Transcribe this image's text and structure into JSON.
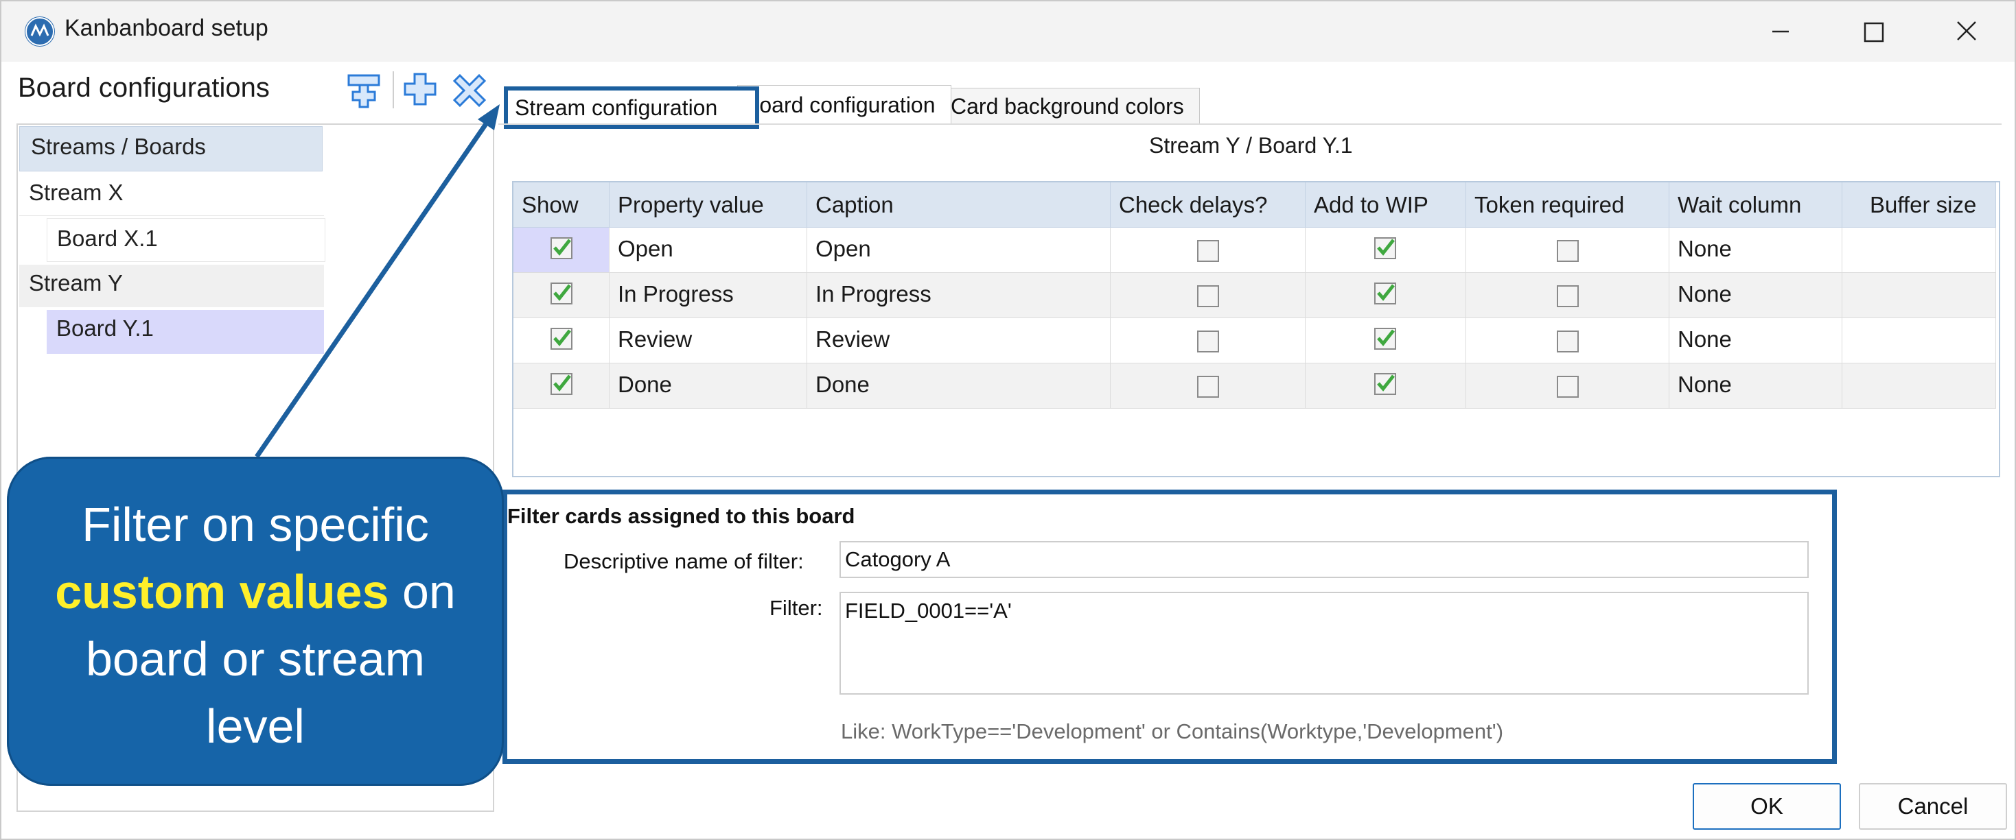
{
  "window": {
    "title": "Kanbanboard setup"
  },
  "left": {
    "heading": "Board configurations",
    "tree": {
      "header": "Streams / Boards",
      "items": [
        {
          "label": "Stream X"
        },
        {
          "label": "Board X.1"
        },
        {
          "label": "Stream Y"
        },
        {
          "label": "Board Y.1"
        }
      ]
    }
  },
  "tabs": [
    {
      "label": "Stream configuration"
    },
    {
      "label": "Board configuration"
    },
    {
      "label": "Card background colors"
    }
  ],
  "panel_title": "Stream Y / Board Y.1",
  "grid": {
    "columns": [
      "Show",
      "Property value",
      "Caption",
      "Check delays?",
      "Add to WIP",
      "Token required",
      "Wait column",
      "Buffer size"
    ],
    "rows": [
      {
        "property": "Open",
        "caption": "Open",
        "wait": "None"
      },
      {
        "property": "In Progress",
        "caption": "In Progress",
        "wait": "None"
      },
      {
        "property": "Review",
        "caption": "Review",
        "wait": "None"
      },
      {
        "property": "Done",
        "caption": "Done",
        "wait": "None"
      }
    ]
  },
  "filter": {
    "title": "Filter cards assigned to this board",
    "name_label": "Descriptive name of filter:",
    "name_value": "Catogory A",
    "filter_label": "Filter:",
    "filter_value": "FIELD_0001=='A'",
    "hint": "Like: WorkType=='Development' or Contains(Worktype,'Development')"
  },
  "buttons": {
    "ok": "OK",
    "cancel": "Cancel"
  },
  "callout": {
    "line1": "Filter on specific",
    "highlight": "custom values",
    "line2_rest": " on",
    "line3": "board or stream",
    "line4": "level"
  },
  "colors": {
    "accent": "#1c5f9e",
    "callout_bg": "#1664a8",
    "highlight": "#ffef2a",
    "check_green": "#3fa83f"
  }
}
